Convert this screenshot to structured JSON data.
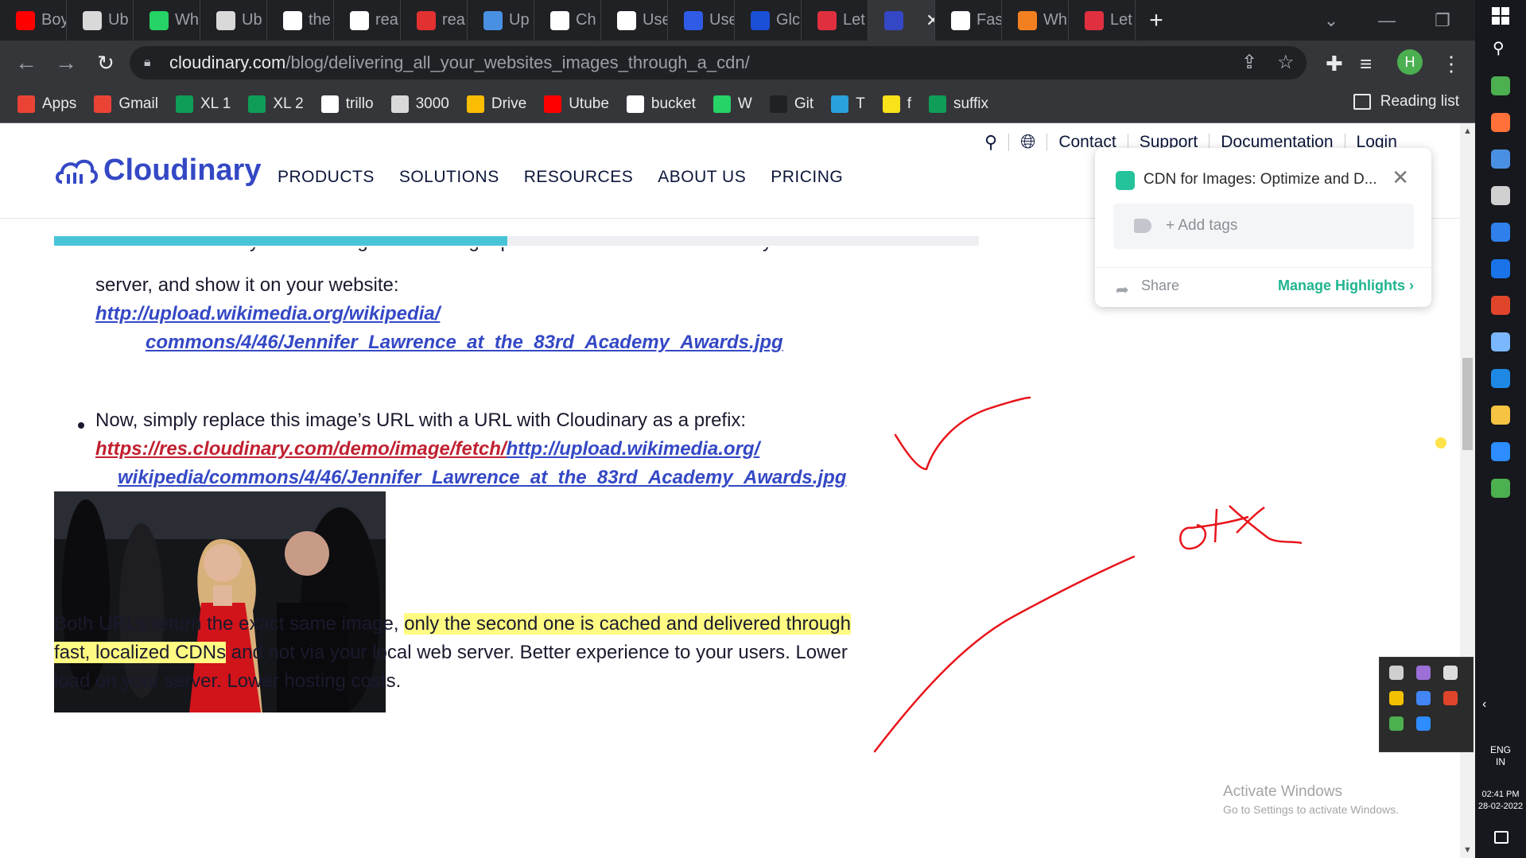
{
  "tabs": [
    {
      "label": "Boy",
      "favicon": "youtube-icon",
      "color": "#ff0000"
    },
    {
      "label": "Ub",
      "favicon": "ubuntu-icon",
      "color": "#d9d9d9"
    },
    {
      "label": "Wh",
      "favicon": "whatsapp-icon",
      "color": "#25d366"
    },
    {
      "label": "Ub",
      "favicon": "ubuntu-icon",
      "color": "#d9d9d9"
    },
    {
      "label": "the",
      "favicon": "google-icon",
      "color": "#ffffff"
    },
    {
      "label": "rea",
      "favicon": "google-icon",
      "color": "#ffffff"
    },
    {
      "label": "rea",
      "favicon": "n-icon",
      "color": "#e23131"
    },
    {
      "label": "Up",
      "favicon": "arrow-icon",
      "color": "#4a90e2"
    },
    {
      "label": "Ch",
      "favicon": "google-icon",
      "color": "#ffffff"
    },
    {
      "label": "Use",
      "favicon": "google-icon",
      "color": "#ffffff"
    },
    {
      "label": "Use",
      "favicon": "powershell-icon",
      "color": "#2f5be7"
    },
    {
      "label": "Glc",
      "favicon": "info-icon",
      "color": "#1a4fd8"
    },
    {
      "label": "Let",
      "favicon": "scaler-icon",
      "color": "#e03040"
    },
    {
      "label": "",
      "favicon": "cloudinary-icon",
      "color": "#3448c5",
      "active": true
    },
    {
      "label": "Fas",
      "favicon": "globe-icon",
      "color": "#ffffff"
    },
    {
      "label": "Wh",
      "favicon": "cloudflare-icon",
      "color": "#f38020"
    },
    {
      "label": "Let",
      "favicon": "scaler-icon",
      "color": "#e03040"
    }
  ],
  "toolbar": {
    "url_host": "cloudinary.com",
    "url_path": "/blog/delivering_all_your_websites_images_through_a_cdn/",
    "profile_initial": "H"
  },
  "bookmarks": [
    {
      "label": "Apps",
      "icon": "apps-grid-icon",
      "color": "#ea4335"
    },
    {
      "label": "Gmail",
      "icon": "gmail-icon",
      "color": "#ea4335"
    },
    {
      "label": "XL 1",
      "icon": "sheets-icon",
      "color": "#0f9d58"
    },
    {
      "label": "XL 2",
      "icon": "sheets-icon",
      "color": "#0f9d58"
    },
    {
      "label": "trillo",
      "icon": "trello-icon",
      "color": "#ffffff"
    },
    {
      "label": "3000",
      "icon": "ubuntu-icon",
      "color": "#d9d9d9"
    },
    {
      "label": "Drive",
      "icon": "drive-icon",
      "color": "#fbbc04"
    },
    {
      "label": "Utube",
      "icon": "youtube-icon",
      "color": "#ff0000"
    },
    {
      "label": "bucket",
      "icon": "globe-icon",
      "color": "#ffffff"
    },
    {
      "label": "W",
      "icon": "whatsapp-icon",
      "color": "#25d366"
    },
    {
      "label": "Git",
      "icon": "github-icon",
      "color": "#202124"
    },
    {
      "label": "T",
      "icon": "telegram-icon",
      "color": "#2aa1da"
    },
    {
      "label": "f",
      "icon": "flipkart-icon",
      "color": "#f8e21a"
    },
    {
      "label": "suffix",
      "icon": "sheets-icon",
      "color": "#0f9d58"
    }
  ],
  "reading_list": "Reading list",
  "site": {
    "logo_text": "Cloudinary",
    "nav": [
      "PRODUCTS",
      "SOLUTIONS",
      "RESOURCES",
      "ABOUT US",
      "PRICING"
    ],
    "top_links": [
      "Contact",
      "Support",
      "Documentation",
      "Login"
    ]
  },
  "reading_progress": 0.49,
  "article": {
    "b1_partial": "Let's assume that you're hosting the following a photo of Jennifer Lawrence on your web",
    "b1_line2": "server, and show it on your website:",
    "b1_link1": "http://upload.wikimedia.org/wikipedia/",
    "b1_link2": "commons/4/46/Jennifer_Lawrence_at_the_83rd_Academy_Awards.jpg",
    "b2_text": "Now, simply replace this image’s URL with a URL with Cloudinary as a prefix:",
    "b2_link_red": "https://res.cloudinary.com/demo/image/fetch/",
    "b2_link_blue": "http://upload.wikimedia.org/",
    "b2_link2": "wikipedia/commons/4/46/Jennifer_Lawrence_at_the_83rd_Academy_Awards.jpg",
    "p_start": "Both URLs return the exact same image, ",
    "p_hl1": "only the second one is cached and delivered through",
    "p_hl2": "fast, localized CDNs",
    "p_rest1": " and not via your local web server. Better experience to your users. Lower",
    "p_rest2": "load on your server. Lower hosting costs."
  },
  "highlighter": {
    "title": "CDN for Images: Optimize and D...",
    "tags_placeholder": "+ Add tags",
    "share": "Share",
    "manage": "Manage Highlights"
  },
  "annotations": {
    "note": "ok",
    "ink_color": "#e8141b"
  },
  "watermark": {
    "line1": "Activate Windows",
    "line2": "Go to Settings to activate Windows."
  },
  "system": {
    "lang": "ENG",
    "region": "IN",
    "time": "02:41 PM",
    "date": "28-02-2022"
  }
}
